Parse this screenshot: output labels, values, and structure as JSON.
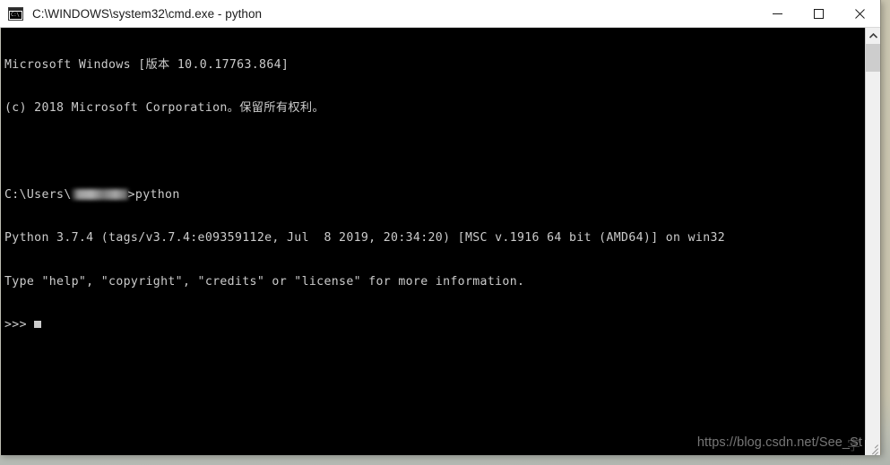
{
  "window": {
    "title": "C:\\WINDOWS\\system32\\cmd.exe - python",
    "icon_name": "cmd-icon",
    "icon_glyph": "C:\\",
    "controls": {
      "minimize_label": "Minimize",
      "maximize_label": "Maximize",
      "close_label": "Close"
    }
  },
  "console": {
    "lines": [
      "Microsoft Windows [版本 10.0.17763.864]",
      "(c) 2018 Microsoft Corporation。保留所有权利。",
      "",
      "",
      "Python 3.7.4 (tags/v3.7.4:e09359112e, Jul  8 2019, 20:34:20) [MSC v.1916 64 bit (AMD64)] on win32",
      "Type \"help\", \"copyright\", \"credits\" or \"license\" for more information."
    ],
    "prompt_line": {
      "prefix": "C:\\Users\\",
      "redacted_user": "",
      "suffix": ">python"
    },
    "python_prompt": ">>> ",
    "cursor": "block",
    "foreground_color": "#cccccc",
    "background_color": "#000000"
  },
  "scrollbar": {
    "up_arrow": "scroll-up-arrow",
    "down_arrow": "scroll-down-arrow",
    "thumb": "scroll-thumb",
    "resize_grip": "resize-grip"
  },
  "watermark": {
    "text": "https://blog.csdn.net/See_St",
    "stamp": "字"
  }
}
